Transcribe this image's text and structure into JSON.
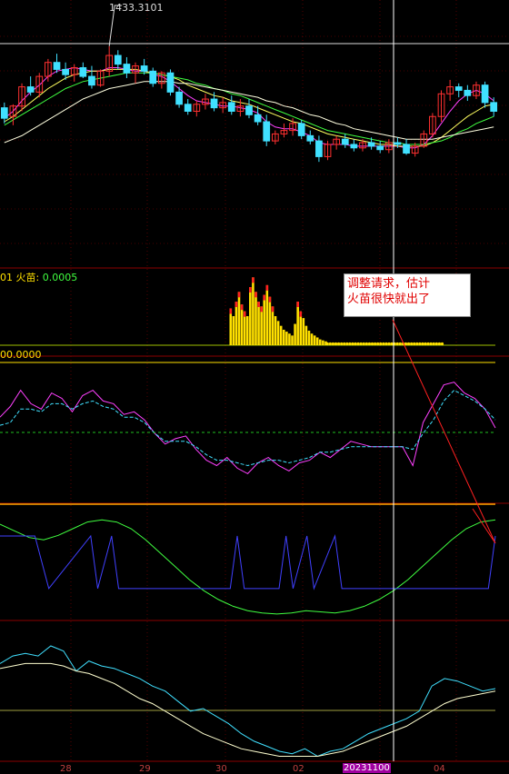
{
  "chart_data": [
    {
      "type": "candlestick",
      "panel": "price",
      "max_label": "1433.3101",
      "candles_ohlc": [
        [
          1398,
          1401,
          1389,
          1392
        ],
        [
          1393,
          1400,
          1388,
          1399
        ],
        [
          1399,
          1412,
          1396,
          1410
        ],
        [
          1410,
          1416,
          1405,
          1407
        ],
        [
          1407,
          1418,
          1404,
          1416
        ],
        [
          1416,
          1426,
          1413,
          1424
        ],
        [
          1424,
          1429,
          1418,
          1420
        ],
        [
          1420,
          1424,
          1414,
          1417
        ],
        [
          1417,
          1423,
          1413,
          1421
        ],
        [
          1421,
          1424,
          1415,
          1416
        ],
        [
          1416,
          1422,
          1409,
          1411
        ],
        [
          1411,
          1420,
          1410,
          1419
        ],
        [
          1419,
          1433.3,
          1416,
          1428
        ],
        [
          1428,
          1431,
          1420,
          1423
        ],
        [
          1423,
          1427,
          1415,
          1418
        ],
        [
          1418,
          1424,
          1412,
          1422
        ],
        [
          1422,
          1426,
          1417,
          1419
        ],
        [
          1419,
          1421,
          1410,
          1412
        ],
        [
          1412,
          1419,
          1409,
          1418
        ],
        [
          1418,
          1420,
          1405,
          1407
        ],
        [
          1407,
          1410,
          1398,
          1400
        ],
        [
          1400,
          1403,
          1394,
          1396
        ],
        [
          1396,
          1402,
          1393,
          1400
        ],
        [
          1400,
          1406,
          1397,
          1403
        ],
        [
          1403,
          1407,
          1396,
          1398
        ],
        [
          1398,
          1404,
          1395,
          1401
        ],
        [
          1401,
          1405,
          1394,
          1396
        ],
        [
          1396,
          1403,
          1393,
          1399
        ],
        [
          1399,
          1403,
          1392,
          1394
        ],
        [
          1394,
          1399,
          1388,
          1390
        ],
        [
          1390,
          1394,
          1376,
          1379
        ],
        [
          1379,
          1385,
          1377,
          1383
        ],
        [
          1383,
          1389,
          1381,
          1385
        ],
        [
          1385,
          1392,
          1382,
          1389
        ],
        [
          1389,
          1391,
          1380,
          1382
        ],
        [
          1382,
          1385,
          1377,
          1379
        ],
        [
          1379,
          1382,
          1367,
          1370
        ],
        [
          1370,
          1379,
          1368,
          1377
        ],
        [
          1377,
          1382,
          1374,
          1380
        ],
        [
          1380,
          1383,
          1375,
          1377
        ],
        [
          1377,
          1380,
          1373,
          1375
        ],
        [
          1375,
          1380,
          1373,
          1378
        ],
        [
          1378,
          1381,
          1374,
          1376
        ],
        [
          1376,
          1379,
          1372,
          1374
        ],
        [
          1374,
          1380,
          1372,
          1378
        ],
        [
          1378,
          1381,
          1375,
          1377
        ],
        [
          1377,
          1380,
          1371,
          1372
        ],
        [
          1372,
          1378,
          1370,
          1376
        ],
        [
          1376,
          1385,
          1375,
          1383
        ],
        [
          1383,
          1395,
          1381,
          1393
        ],
        [
          1393,
          1408,
          1390,
          1406
        ],
        [
          1406,
          1414,
          1402,
          1410
        ],
        [
          1410,
          1412,
          1404,
          1408
        ],
        [
          1408,
          1411,
          1402,
          1405
        ],
        [
          1405,
          1413,
          1403,
          1411
        ],
        [
          1411,
          1413,
          1398,
          1401
        ],
        [
          1401,
          1404,
          1393,
          1396
        ]
      ],
      "mas": [
        {
          "color": "#ff40ff",
          "values": [
            1392,
            1396,
            1402,
            1407,
            1411,
            1416,
            1419,
            1420,
            1421,
            1420,
            1419,
            1419,
            1421,
            1421,
            1420,
            1419,
            1419,
            1417,
            1416,
            1413,
            1409,
            1405,
            1402,
            1401,
            1400,
            1399,
            1399,
            1398,
            1397,
            1395,
            1390,
            1387,
            1386,
            1386,
            1384,
            1382,
            1378,
            1377,
            1377,
            1377,
            1376,
            1376,
            1376,
            1376,
            1376,
            1376,
            1375,
            1375,
            1377,
            1382,
            1389,
            1396,
            1402,
            1406,
            1408,
            1406,
            1402
          ]
        },
        {
          "color": "#ffff60",
          "values": [
            1390,
            1393,
            1397,
            1401,
            1405,
            1409,
            1412,
            1415,
            1417,
            1418,
            1419,
            1419,
            1420,
            1420,
            1420,
            1420,
            1419,
            1418,
            1417,
            1416,
            1414,
            1411,
            1409,
            1407,
            1405,
            1404,
            1402,
            1401,
            1400,
            1398,
            1396,
            1394,
            1392,
            1390,
            1389,
            1387,
            1385,
            1383,
            1382,
            1381,
            1380,
            1379,
            1378,
            1377,
            1377,
            1376,
            1376,
            1376,
            1376,
            1378,
            1381,
            1385,
            1389,
            1393,
            1396,
            1399,
            1400
          ]
        },
        {
          "color": "#40ff40",
          "values": [
            1388,
            1391,
            1394,
            1397,
            1400,
            1403,
            1406,
            1409,
            1411,
            1413,
            1414,
            1415,
            1416,
            1417,
            1418,
            1418,
            1418,
            1418,
            1417,
            1416,
            1415,
            1414,
            1412,
            1411,
            1409,
            1408,
            1406,
            1405,
            1403,
            1401,
            1399,
            1397,
            1395,
            1393,
            1391,
            1389,
            1387,
            1385,
            1384,
            1383,
            1382,
            1381,
            1380,
            1379,
            1378,
            1378,
            1377,
            1377,
            1377,
            1378,
            1379,
            1381,
            1384,
            1386,
            1389,
            1391,
            1393
          ]
        },
        {
          "color": "#ffffe0",
          "values": [
            1378,
            1380,
            1382,
            1385,
            1388,
            1391,
            1394,
            1397,
            1400,
            1403,
            1405,
            1407,
            1409,
            1410,
            1411,
            1412,
            1413,
            1413,
            1413,
            1413,
            1412,
            1412,
            1411,
            1410,
            1409,
            1408,
            1407,
            1406,
            1405,
            1404,
            1402,
            1401,
            1399,
            1398,
            1396,
            1394,
            1393,
            1391,
            1389,
            1388,
            1386,
            1385,
            1384,
            1383,
            1382,
            1381,
            1380,
            1380,
            1380,
            1380,
            1381,
            1382,
            1383,
            1384,
            1385,
            1386,
            1387
          ]
        }
      ],
      "ylim": [
        1340,
        1440
      ]
    },
    {
      "type": "bar",
      "panel": "indicator",
      "label_prefix": "01 ",
      "label_name": "火苗: ",
      "label_value": "0.0005",
      "baseline_label": "00.0000",
      "values": [
        0,
        0,
        0,
        0,
        0,
        0,
        0,
        0,
        0,
        0,
        0,
        0,
        0,
        0,
        0,
        0,
        0,
        0,
        0,
        0,
        0,
        0,
        0,
        0,
        0,
        0,
        0,
        0,
        0,
        0,
        0,
        0,
        0,
        0,
        0,
        0,
        0,
        0,
        0,
        0,
        0,
        0,
        0,
        0,
        0,
        0,
        0,
        0,
        0,
        0,
        0,
        0,
        0,
        0,
        0,
        0,
        0,
        0,
        0,
        0,
        0,
        0,
        0,
        0,
        0,
        0,
        0,
        0,
        0,
        0,
        0,
        0,
        0,
        0,
        0,
        0,
        0,
        0,
        0,
        0,
        0,
        0,
        38,
        30,
        45,
        55,
        42,
        35,
        30,
        60,
        70,
        55,
        45,
        40,
        52,
        62,
        50,
        40,
        30,
        25,
        20,
        16,
        14,
        12,
        10,
        22,
        45,
        35,
        28,
        20,
        15,
        12,
        10,
        8,
        6,
        5,
        4,
        3,
        3,
        3,
        3,
        3,
        3,
        3,
        3,
        3,
        3,
        3,
        3,
        3,
        3,
        3,
        3,
        3,
        3,
        3,
        3,
        3,
        3,
        3,
        3,
        3,
        3,
        3,
        3,
        3,
        3,
        3,
        3,
        3,
        3,
        3,
        3,
        3,
        3,
        3,
        3,
        3,
        3,
        0,
        0,
        0,
        0,
        0,
        0,
        0,
        0,
        0,
        0,
        0,
        0,
        0,
        0,
        0,
        0,
        0,
        0
      ],
      "ylim": [
        0,
        75
      ]
    },
    {
      "type": "line",
      "panel": "oscillator1",
      "series": [
        {
          "color": "#ff40ff",
          "values": [
            60,
            68,
            80,
            70,
            66,
            78,
            74,
            64,
            76,
            80,
            72,
            70,
            62,
            64,
            58,
            48,
            40,
            44,
            46,
            36,
            28,
            24,
            30,
            22,
            18,
            26,
            30,
            24,
            20,
            26,
            28,
            34,
            30,
            36,
            42,
            40,
            38,
            38,
            38,
            38,
            24,
            56,
            70,
            84,
            86,
            78,
            74,
            66,
            52
          ]
        },
        {
          "color": "#40e0ff",
          "values": [
            54,
            56,
            66,
            66,
            64,
            70,
            70,
            66,
            70,
            72,
            68,
            66,
            60,
            60,
            56,
            48,
            42,
            42,
            42,
            38,
            32,
            28,
            28,
            26,
            24,
            26,
            28,
            28,
            26,
            28,
            30,
            34,
            34,
            36,
            38,
            38,
            38,
            38,
            38,
            38,
            36,
            48,
            58,
            72,
            80,
            76,
            72,
            66,
            58
          ]
        }
      ],
      "ylim": [
        0,
        100
      ]
    },
    {
      "type": "line",
      "panel": "oscillator2",
      "series": [
        {
          "color": "#40ff40",
          "values": [
            86,
            80,
            74,
            72,
            76,
            82,
            88,
            90,
            88,
            82,
            72,
            60,
            48,
            36,
            26,
            18,
            12,
            8,
            6,
            5,
            6,
            8,
            7,
            6,
            8,
            12,
            18,
            26,
            36,
            48,
            60,
            72,
            82,
            88,
            90
          ]
        },
        {
          "color": "#4040ff",
          "steps": [
            [
              0,
              1
            ],
            [
              5,
              1
            ],
            [
              7,
              0
            ],
            [
              13,
              1
            ],
            [
              14,
              0
            ],
            [
              16,
              1
            ],
            [
              17,
              0
            ],
            [
              33,
              0
            ],
            [
              34,
              1
            ],
            [
              35,
              0
            ],
            [
              36,
              0
            ],
            [
              40,
              0
            ],
            [
              41,
              1
            ],
            [
              42,
              0
            ],
            [
              44,
              1
            ],
            [
              45,
              0
            ],
            [
              48,
              1
            ],
            [
              49,
              0
            ],
            [
              70,
              0
            ],
            [
              71,
              1
            ]
          ]
        }
      ],
      "ylim": [
        0,
        100
      ]
    },
    {
      "type": "line",
      "panel": "oscillator3",
      "series": [
        {
          "color": "#40e0ff",
          "values": [
            78,
            84,
            86,
            84,
            92,
            88,
            72,
            80,
            76,
            74,
            70,
            66,
            60,
            56,
            48,
            40,
            42,
            36,
            30,
            22,
            16,
            12,
            8,
            6,
            10,
            4,
            8,
            10,
            16,
            22,
            26,
            30,
            34,
            40,
            60,
            66,
            64,
            60,
            56,
            58
          ]
        },
        {
          "color": "#ffffd0",
          "values": [
            74,
            76,
            78,
            78,
            78,
            76,
            72,
            70,
            66,
            62,
            56,
            50,
            46,
            40,
            34,
            28,
            22,
            18,
            14,
            10,
            8,
            6,
            4,
            4,
            4,
            4,
            6,
            8,
            12,
            16,
            20,
            24,
            28,
            34,
            40,
            46,
            50,
            52,
            54,
            56
          ]
        }
      ],
      "ylim": [
        0,
        100
      ]
    }
  ],
  "x_axis": {
    "ticks": [
      "28",
      "29",
      "30",
      "02",
      "04"
    ],
    "highlight": "20231100"
  },
  "annotation": {
    "line1": "调整请求，估计",
    "line2": "火苗很快就出了"
  },
  "colors": {
    "up": "#ff3030",
    "down": "#40e0ff",
    "grid": "#8b0000",
    "flame": "#ffe000",
    "baseline": "#ffa500"
  }
}
